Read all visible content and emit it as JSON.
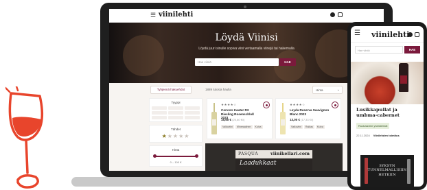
{
  "colors": {
    "accent": "#7b1a3c",
    "illustration": "#e8452c",
    "device_frame": "#1f1f1f"
  },
  "laptop_site": {
    "header": {
      "menu_icon": "hamburger-icon",
      "logo": "viinilehti",
      "social_icons": [
        "facebook-icon",
        "instagram-icon"
      ]
    },
    "hero": {
      "title": "Löydä Viinisi",
      "subtitle": "Löydä juuri sinulle sopiva viini vertaamalla viinejä tai hakemalla",
      "search_placeholder": "Hae viiniä",
      "search_button": "HAE"
    },
    "filters": {
      "chip_label": "Tyhjennä hakuehdot",
      "results_count": "1889 tulosta haulla",
      "sort_label": "Hinta"
    },
    "sidebar": {
      "type_title": "Tyyppi",
      "stars_title": "Tähdet",
      "stars_rating": 1,
      "stars_max": 5,
      "price_title": "Hinta",
      "price_range": "0 – 100 €"
    },
    "products": [
      {
        "name": "Corvers Kauter R3 Riesling Rosenschloß 2023",
        "price": "15,60 €",
        "unit_price": "(20,80 €/l)",
        "tags": [
          "Valkoviini",
          "Mineraalinen",
          "Kuiva"
        ]
      },
      {
        "name": "Leyda Reserva Sauvignon Blanc 2023",
        "price": "13,00 €",
        "unit_price": "(17,33 €/l)",
        "tags": [
          "Valkoviini",
          "Raikas",
          "Kuiva"
        ]
      }
    ],
    "ad": {
      "brand": "PASQUA",
      "shop": "viinikellari.com",
      "script_text": "Laadukkaat"
    }
  },
  "phone_site": {
    "header": {
      "menu_icon": "hamburger-icon",
      "logo": "viinilehti",
      "social_icons": [
        "facebook-icon",
        "instagram-icon"
      ]
    },
    "search_placeholder": "Hae viiniä",
    "search_button": "HAE",
    "article": {
      "title": "Lusikkapullat ja umbma-cabernet",
      "tag": "Ruoka&viini yhdistelmät",
      "date": "22.11.2024",
      "author": "Viinilehden toimitus"
    },
    "ad": {
      "text": "SYKSYN TUNNELMALLISIIN HETKIIN"
    }
  }
}
